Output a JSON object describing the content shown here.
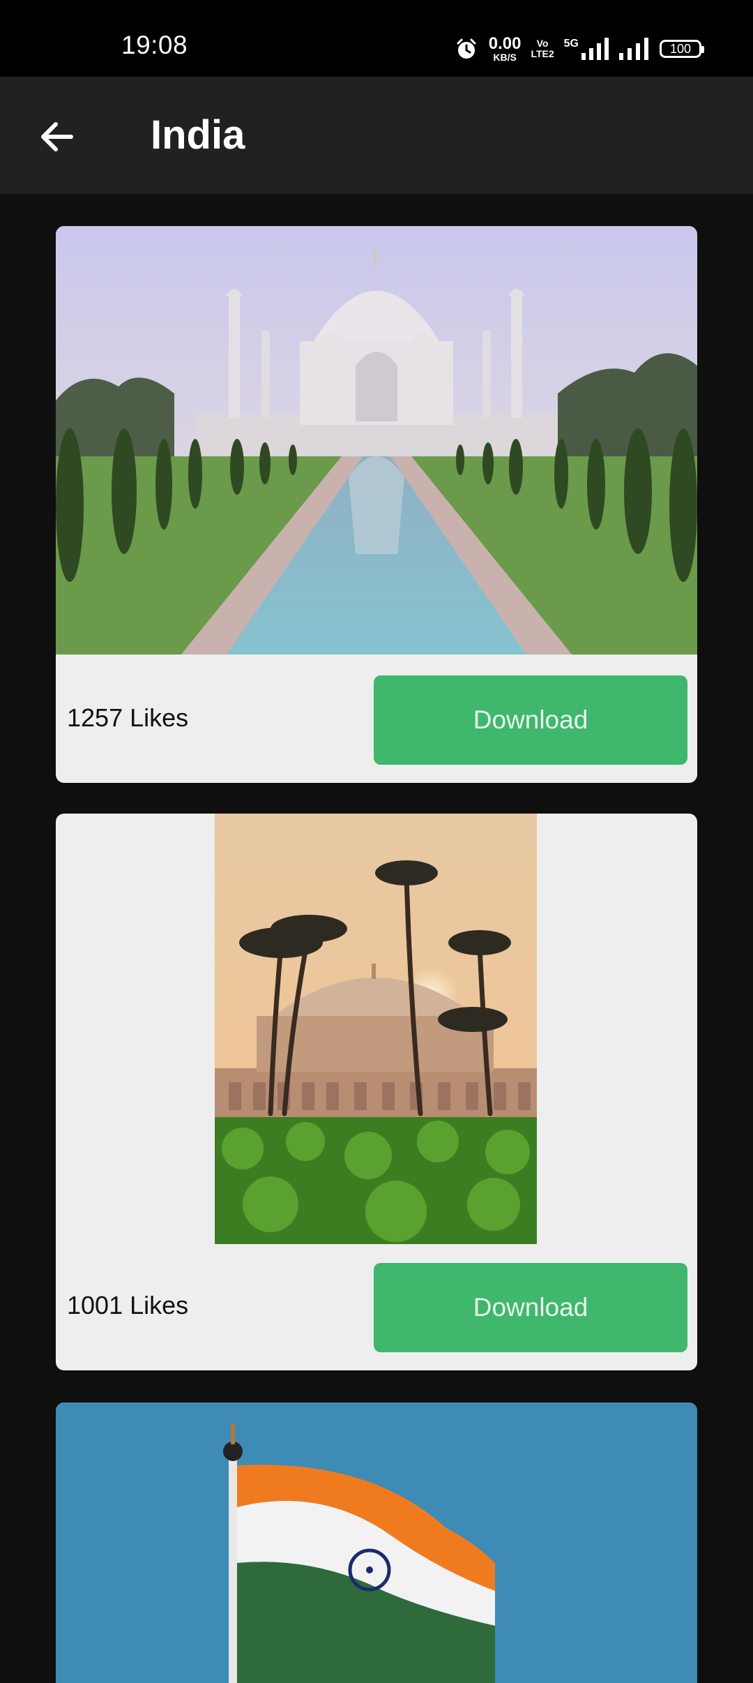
{
  "status_bar": {
    "time": "19:08",
    "network_speed_value": "0.00",
    "network_speed_unit": "KB/S",
    "volte_top": "Vo",
    "volte_bottom": "LTE2",
    "network_type": "5G",
    "battery_level": "100"
  },
  "app_bar": {
    "title": "India",
    "back_icon": "arrow-left-icon"
  },
  "cards": [
    {
      "likes": "1257 Likes",
      "download_label": "Download",
      "image_subject": "Taj Mahal with reflecting pool"
    },
    {
      "likes": "1001 Likes",
      "download_label": "Download",
      "image_subject": "Humayun's Tomb with palm trees"
    },
    {
      "image_subject": "Indian national flag on flagpole"
    }
  ],
  "colors": {
    "background": "#0f0f0f",
    "app_bar": "#212121",
    "card": "#eeeeee",
    "download_button": "#3fb76d"
  }
}
